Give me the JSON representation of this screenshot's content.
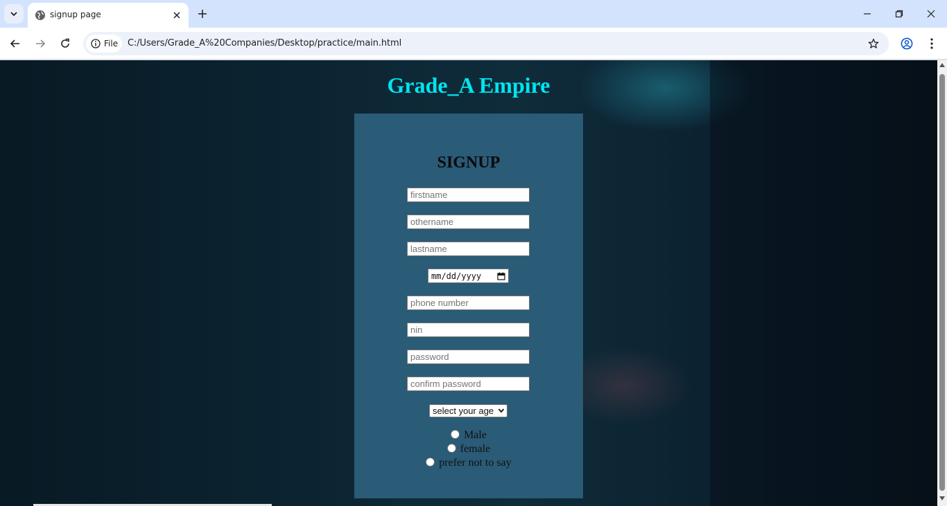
{
  "browser": {
    "tab_title": "signup page",
    "site_chip_label": "File",
    "url": "C:/Users/Grade_A%20Companies/Desktop/practice/main.html"
  },
  "page": {
    "site_title": "Grade_A Empire",
    "form": {
      "heading": "SIGNUP",
      "firstname_placeholder": "firstname",
      "othername_placeholder": "othername",
      "lastname_placeholder": "lastname",
      "date_placeholder": "mm/dd/yyyy",
      "phone_placeholder": "phone number",
      "nin_placeholder": "nin",
      "password_placeholder": "password",
      "confirm_password_placeholder": "confirm password",
      "age_select_value": "select your age",
      "gender_options": [
        "Male",
        "female",
        "prefer not to say"
      ]
    }
  },
  "colors": {
    "title": "#00e5f0",
    "card_background": "#2a5b77",
    "tabstrip": "#d3e3fd"
  }
}
